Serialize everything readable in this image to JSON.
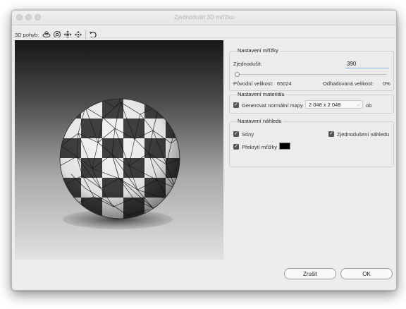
{
  "window": {
    "title": "Zjednodušit 3D mřížku"
  },
  "toolbar": {
    "label": "3D pohyb:",
    "tools": [
      "orbit-3d-icon",
      "roll-3d-icon",
      "pan-3d-icon",
      "slide-3d-icon",
      "reset-view-icon"
    ]
  },
  "mesh_settings": {
    "title": "Nastavení mřížky",
    "simplify_label": "Zjednodušit:",
    "simplify_value": "390",
    "simplify_slider_fraction": 0.01,
    "original_size_label": "Původní velikost:",
    "original_size_value": "65024",
    "estimated_size_label": "Odhadovaná velikost:",
    "estimated_size_value": "0%"
  },
  "material_settings": {
    "title": "Nastavení materiálu",
    "generate_normal_maps_label": "Generovat normální mapy",
    "generate_normal_maps_checked": true,
    "map_size_value": "2 048 x 2 048",
    "map_unit": "ob"
  },
  "preview_settings": {
    "title": "Nastavení náhledu",
    "shadows_label": "Stíny",
    "shadows_checked": true,
    "simplified_preview_label": "Zjednodušení náhledu",
    "simplified_preview_checked": true,
    "mesh_overlay_label": "Překrytí mřížky",
    "mesh_overlay_checked": true,
    "mesh_overlay_color": "#000000"
  },
  "buttons": {
    "cancel": "Zrušit",
    "ok": "OK"
  }
}
